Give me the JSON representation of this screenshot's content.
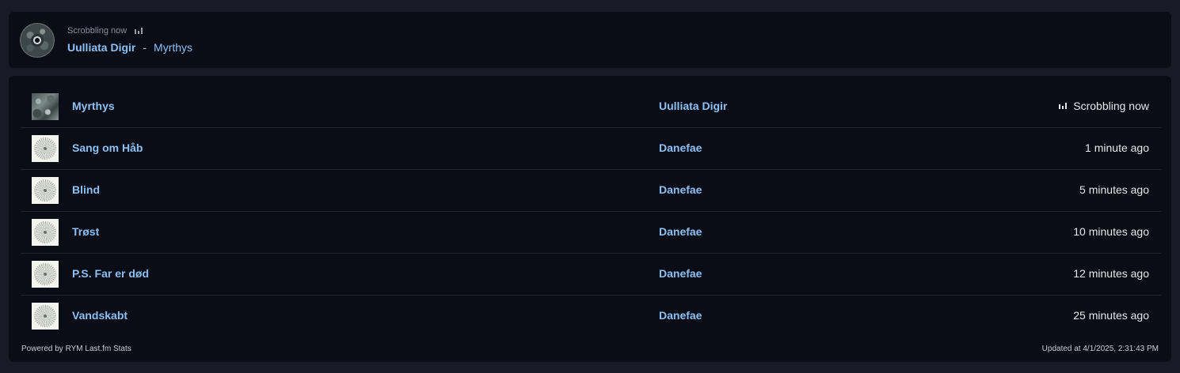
{
  "now_playing": {
    "status": "Scrobbling now",
    "artist": "Uulliata Digir",
    "separator": "-",
    "track": "Myrthys"
  },
  "tracks": [
    {
      "title": "Myrthys",
      "artist": "Uulliata Digir",
      "time": "Scrobbling now",
      "now": true
    },
    {
      "title": "Sang om Håb",
      "artist": "Danefae",
      "time": "1 minute ago",
      "now": false
    },
    {
      "title": "Blind",
      "artist": "Danefae",
      "time": "5 minutes ago",
      "now": false
    },
    {
      "title": "Trøst",
      "artist": "Danefae",
      "time": "10 minutes ago",
      "now": false
    },
    {
      "title": "P.S. Far er død",
      "artist": "Danefae",
      "time": "12 minutes ago",
      "now": false
    },
    {
      "title": "Vandskabt",
      "artist": "Danefae",
      "time": "25 minutes ago",
      "now": false
    }
  ],
  "footer": {
    "powered_by": "Powered by RYM Last.fm Stats",
    "updated": "Updated at 4/1/2025, 2:31:43 PM"
  },
  "colors": {
    "background": "#181b25",
    "card": "#0b0d16",
    "link": "#8cc0f5",
    "text": "#e6e8ee"
  }
}
